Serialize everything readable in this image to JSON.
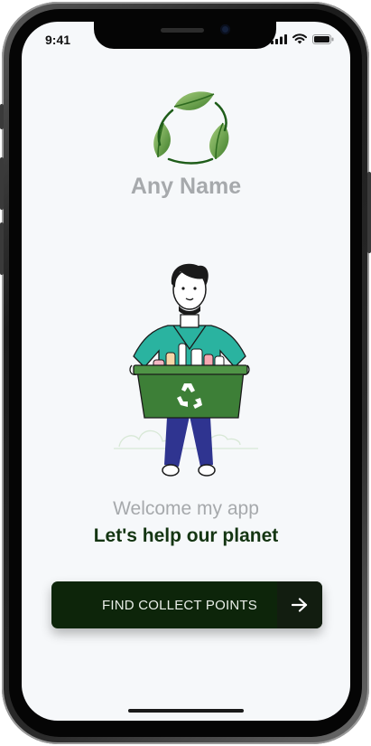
{
  "status_bar": {
    "time": "9:41",
    "icons": [
      "cellular-signal-icon",
      "wifi-icon",
      "battery-icon"
    ]
  },
  "app": {
    "logo_icon": "recycle-leaves-icon",
    "name": "Any Name"
  },
  "illustration": {
    "subject": "person-carrying-recycling-bin",
    "bin_symbol": "recycle-symbol-icon"
  },
  "welcome": {
    "line1": "Welcome my app",
    "line2": "Let's help our planet"
  },
  "cta": {
    "label": "FIND COLLECT POINTS",
    "icon": "arrow-right-icon"
  },
  "colors": {
    "background": "#f6f8fa",
    "muted_text": "#a6a9ac",
    "brand_dark": "#143512",
    "button": "#0d250a",
    "leaf_green": "#5e9b3e",
    "bin_green": "#3d7f37",
    "shirt_teal": "#2ab3a0",
    "pants_navy": "#2f3490"
  }
}
